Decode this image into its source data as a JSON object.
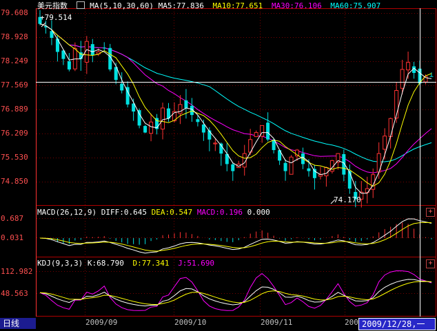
{
  "price_panel": {
    "title": "美元指数",
    "ma_label": "MA(5,10,30,60)",
    "ma5": "MA5:77.836",
    "ma10": "MA10:77.651",
    "ma30": "MA30:76.106",
    "ma60": "MA60:75.907",
    "y_ticks": [
      "79.608",
      "78.928",
      "78.249",
      "77.569",
      "76.889",
      "76.209",
      "75.530",
      "74.850"
    ],
    "high_marker": "79.514",
    "low_marker": "74.170"
  },
  "macd_panel": {
    "label": "MACD(26,12,9)",
    "diff": "DIFF:0.645",
    "dea": "DEA:0.547",
    "macd": "MACD:0.196",
    "zero": "0.000",
    "y_ticks": [
      "0.687",
      "0.031"
    ],
    "toggle": "+"
  },
  "kdj_panel": {
    "label": "KDJ(9,3,3)",
    "k": "K:68.790",
    "d": "D:77.341",
    "j": "J:51.690",
    "y_ticks": [
      "112.982",
      "48.563"
    ],
    "toggle": "+"
  },
  "footer": {
    "period_tab": "日线",
    "x_ticks": [
      "2009/09",
      "2009/10",
      "2009/11",
      "200"
    ],
    "cursor_date": "2009/12/28,一"
  },
  "colors": {
    "up": "#ff3232",
    "down": "#00e0e0",
    "ma5": "#ffffff",
    "ma10": "#ffff00",
    "ma30": "#ff00ff",
    "ma60": "#00ffff",
    "grid": "#7a0000",
    "axis": "#ff3232"
  },
  "chart_data": {
    "type": "candlestick",
    "title": "美元指数",
    "x_axis": [
      "2009/09",
      "2009/10",
      "2009/11",
      "200"
    ],
    "ylim": [
      74.17,
      79.608
    ],
    "price_high": 79.514,
    "price_low": 74.17,
    "ma_last": {
      "MA5": 77.836,
      "MA10": 77.651,
      "MA30": 76.106,
      "MA60": 75.907
    },
    "macd_last": {
      "DIFF": 0.645,
      "DEA": 0.547,
      "MACD": 0.196
    },
    "kdj_last": {
      "K": 68.79,
      "D": 77.341,
      "J": 51.69
    },
    "close_path": [
      79.3,
      79.2,
      78.9,
      78.5,
      78.3,
      78.0,
      78.6,
      78.3,
      78.8,
      78.4,
      78.5,
      78.6,
      78.0,
      77.7,
      77.4,
      77.0,
      76.8,
      76.4,
      76.2,
      76.5,
      76.3,
      76.9,
      76.6,
      76.8,
      77.0,
      76.9,
      76.7,
      76.5,
      76.2,
      76.0,
      75.9,
      75.6,
      75.3,
      75.1,
      75.3,
      75.6,
      76.0,
      76.2,
      76.4,
      76.0,
      75.7,
      75.4,
      75.1,
      75.5,
      75.7,
      75.3,
      75.1,
      74.9,
      75.0,
      75.2,
      75.4,
      75.6,
      75.0,
      74.6,
      74.3,
      74.5,
      74.6,
      75.0,
      75.6,
      76.1,
      76.6,
      77.4,
      78.0,
      78.2,
      77.9,
      77.6,
      77.8,
      77.8
    ]
  }
}
